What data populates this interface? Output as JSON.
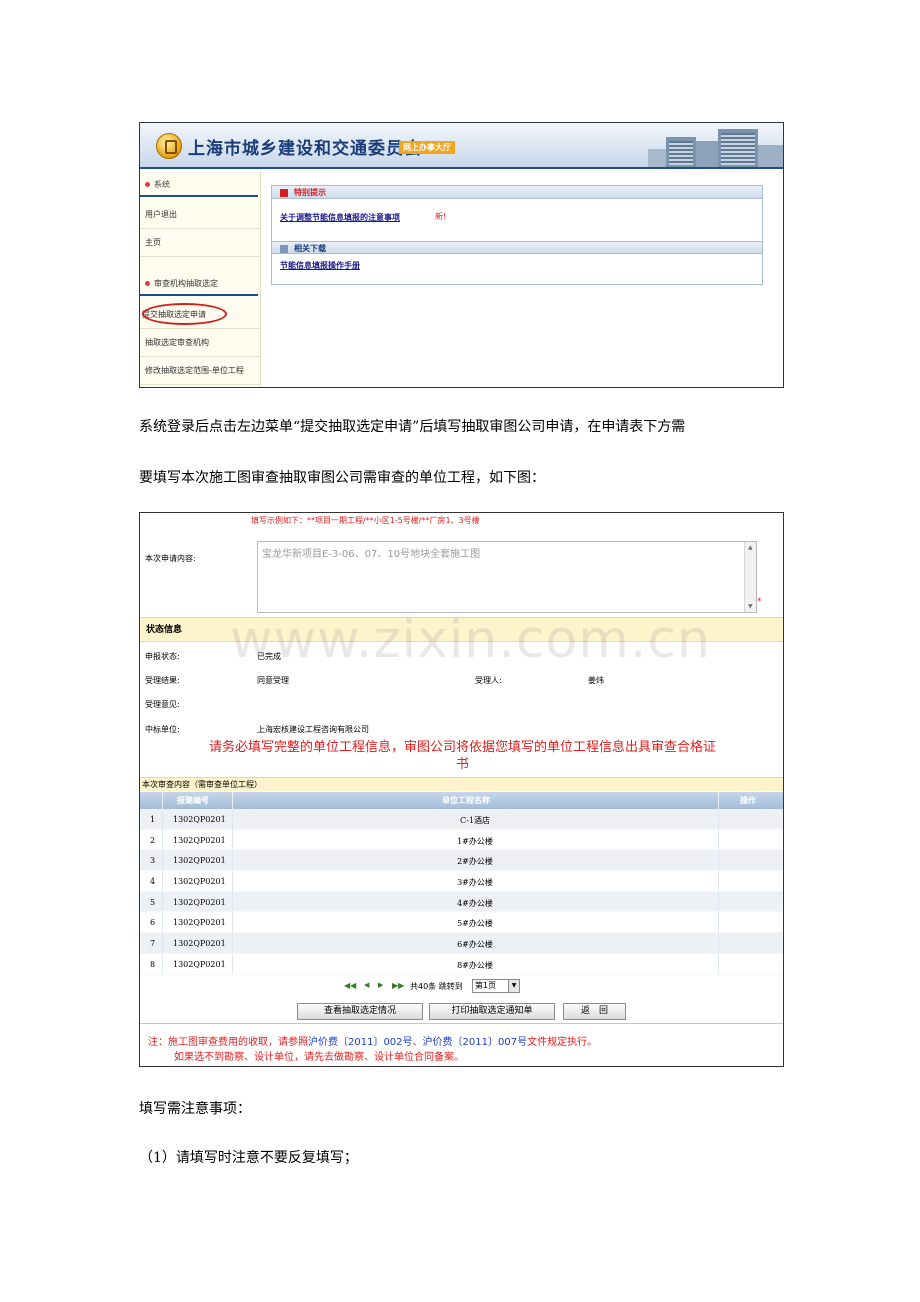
{
  "screenshot1": {
    "banner": {
      "title": "上海市城乡建设和交通委员会",
      "badge": "网上办事大厅"
    },
    "sidebar": {
      "system_header": "系统",
      "logout": "用户退出",
      "home": "主页",
      "review_header": "审查机构抽取选定",
      "submit_apply": "提交抽取选定申请",
      "select_agency": "抽取选定审查机构",
      "modify_scope": "修改抽取选定范围-单位工程"
    },
    "notice_panel": {
      "title": "特别提示",
      "link": "关于调整节能信息填报的注意事项",
      "new_label": "新!"
    },
    "download_panel": {
      "title": "相关下载",
      "link": "节能信息填报操作手册"
    }
  },
  "paragraphs": {
    "p1_line1": "系统登录后点击左边菜单“提交抽取选定申请”后填写抽取审图公司申请，在申请表下方需",
    "p1_line2": "要填写本次施工图审查抽取审图公司需审查的单位工程，如下图：",
    "p2": "填写需注意事项：",
    "p3": "（1）请填写时注意不要反复填写；"
  },
  "screenshot2": {
    "example_hint": "填写示例如下：**项目一期工程/**小区1-5号楼/**厂房1、3号楼",
    "apply_label": "本次申请内容:",
    "apply_value": "宝龙华新项目E-3-06、07、10号地块全套施工图",
    "required_mark": "*",
    "status_title": "状态信息",
    "status_label": "申报状态:",
    "status_value": "已完成",
    "result_label": "受理结果:",
    "result_value": "同意受理",
    "handler_label": "受理人:",
    "handler_value": "姜炜",
    "opinion_label": "受理意见:",
    "winner_label": "中标单位:",
    "winner_value": "上海宏核建设工程咨询有限公司",
    "warning_line1": "请务必填写完整的单位工程信息，审图公司将依据您填写的单位工程信息出具审查合格证",
    "warning_line2": "书",
    "section_title": "本次审查内容（需审查单位工程）",
    "grid_headers": [
      "报建编号",
      "单位工程名称",
      "操作"
    ],
    "grid_rows": [
      {
        "no": "1",
        "code": "1302QP0201",
        "name": "C-1酒店"
      },
      {
        "no": "2",
        "code": "1302QP0201",
        "name": "1#办公楼"
      },
      {
        "no": "3",
        "code": "1302QP0201",
        "name": "2#办公楼"
      },
      {
        "no": "4",
        "code": "1302QP0201",
        "name": "3#办公楼"
      },
      {
        "no": "5",
        "code": "1302QP0201",
        "name": "4#办公楼"
      },
      {
        "no": "6",
        "code": "1302QP0201",
        "name": "5#办公楼"
      },
      {
        "no": "7",
        "code": "1302QP0201",
        "name": "6#办公楼"
      },
      {
        "no": "8",
        "code": "1302QP0201",
        "name": "8#办公楼"
      }
    ],
    "pager_text": "共40条 跳转到",
    "pager_select": "第1页",
    "btn_view": "查看抽取选定情况",
    "btn_print": "打印抽取选定通知单",
    "btn_back": "返　回",
    "note_prefix": "注：施工图审查费用的收取，请参照",
    "note_ref1": "沪价费〔2011〕002号",
    "note_sep": "、",
    "note_ref2": "沪价费〔2011〕007号",
    "note_suffix": "文件规定执行。",
    "note_line2": "如果选不到勘察、设计单位，请先去做勘察、设计单位合同备案。"
  },
  "watermark": "www.zixin.com.cn"
}
